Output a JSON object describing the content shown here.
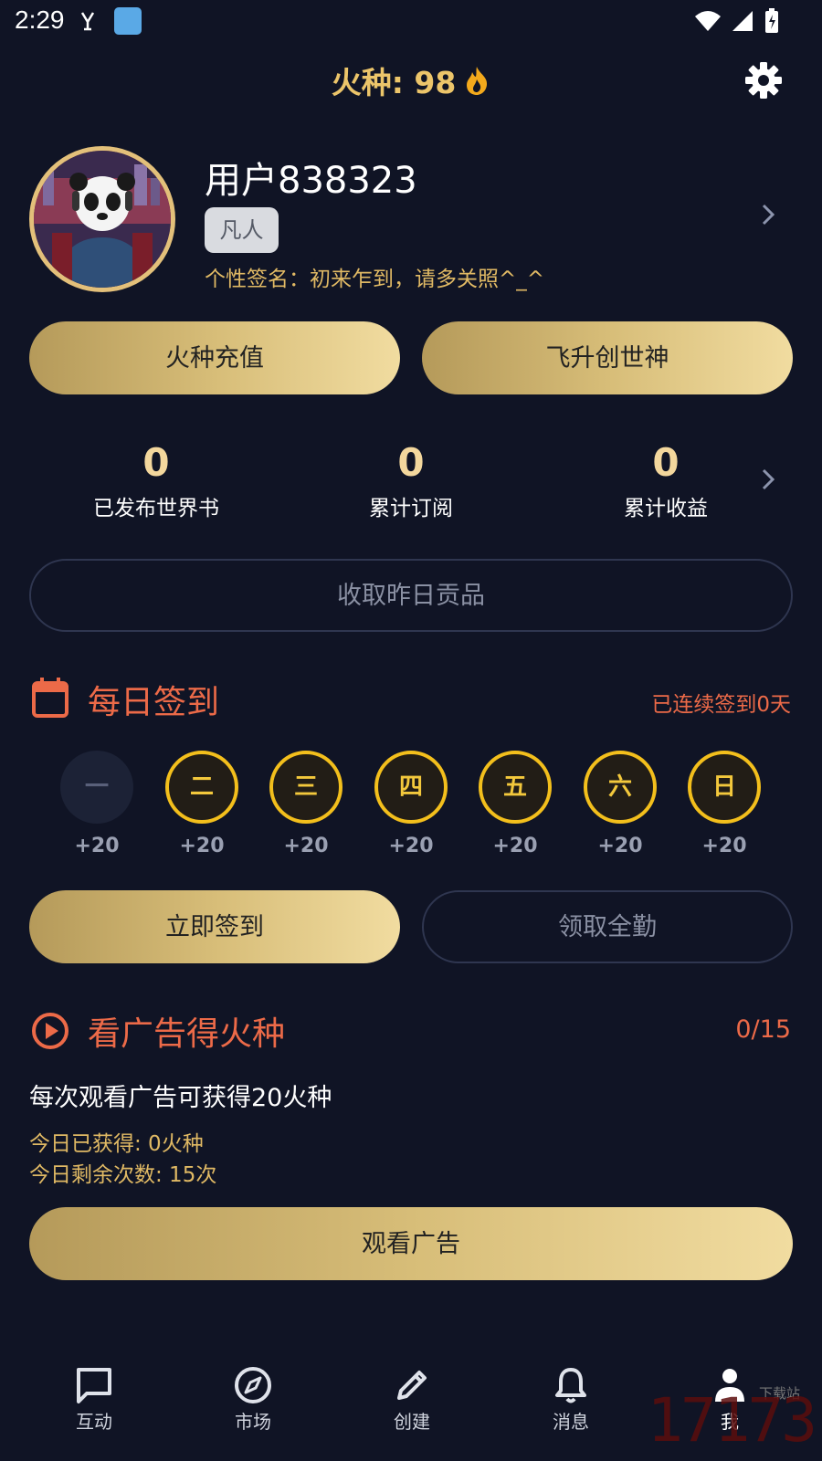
{
  "status_bar": {
    "time": "2:29"
  },
  "header": {
    "title": "火种: 98"
  },
  "profile": {
    "username": "用户838323",
    "rank": "凡人",
    "signature": "个性签名：初来乍到，请多关照^_^"
  },
  "actions": {
    "recharge": "火种充值",
    "ascend": "飞升创世神"
  },
  "stats": [
    {
      "value": "0",
      "label": "已发布世界书"
    },
    {
      "value": "0",
      "label": "累计订阅"
    },
    {
      "value": "0",
      "label": "累计收益"
    }
  ],
  "collect_button": "收取昨日贡品",
  "checkin": {
    "title": "每日签到",
    "streak": "已连续签到0天",
    "days": [
      {
        "label": "一",
        "reward": "+20",
        "done": true
      },
      {
        "label": "二",
        "reward": "+20",
        "done": false
      },
      {
        "label": "三",
        "reward": "+20",
        "done": false
      },
      {
        "label": "四",
        "reward": "+20",
        "done": false
      },
      {
        "label": "五",
        "reward": "+20",
        "done": false
      },
      {
        "label": "六",
        "reward": "+20",
        "done": false
      },
      {
        "label": "日",
        "reward": "+20",
        "done": false
      }
    ],
    "checkin_button": "立即签到",
    "full_attendance_button": "领取全勤"
  },
  "ads": {
    "title": "看广告得火种",
    "progress": "0/15",
    "description": "每次观看广告可获得20火种",
    "earned_today": "今日已获得: 0火种",
    "remaining_today": "今日剩余次数: 15次",
    "watch_button": "观看广告"
  },
  "nav": [
    {
      "label": "互动",
      "icon": "chat-icon"
    },
    {
      "label": "市场",
      "icon": "compass-icon"
    },
    {
      "label": "创建",
      "icon": "pencil-icon"
    },
    {
      "label": "消息",
      "icon": "bell-icon"
    },
    {
      "label": "我",
      "icon": "person-icon",
      "active": true
    }
  ],
  "watermark": {
    "main": "17173",
    "sub": "下载站"
  },
  "colors": {
    "background": "#101425",
    "gold": "#ecc56a",
    "accent_orange": "#ec6a48",
    "day_ring": "#f3bf1c"
  }
}
